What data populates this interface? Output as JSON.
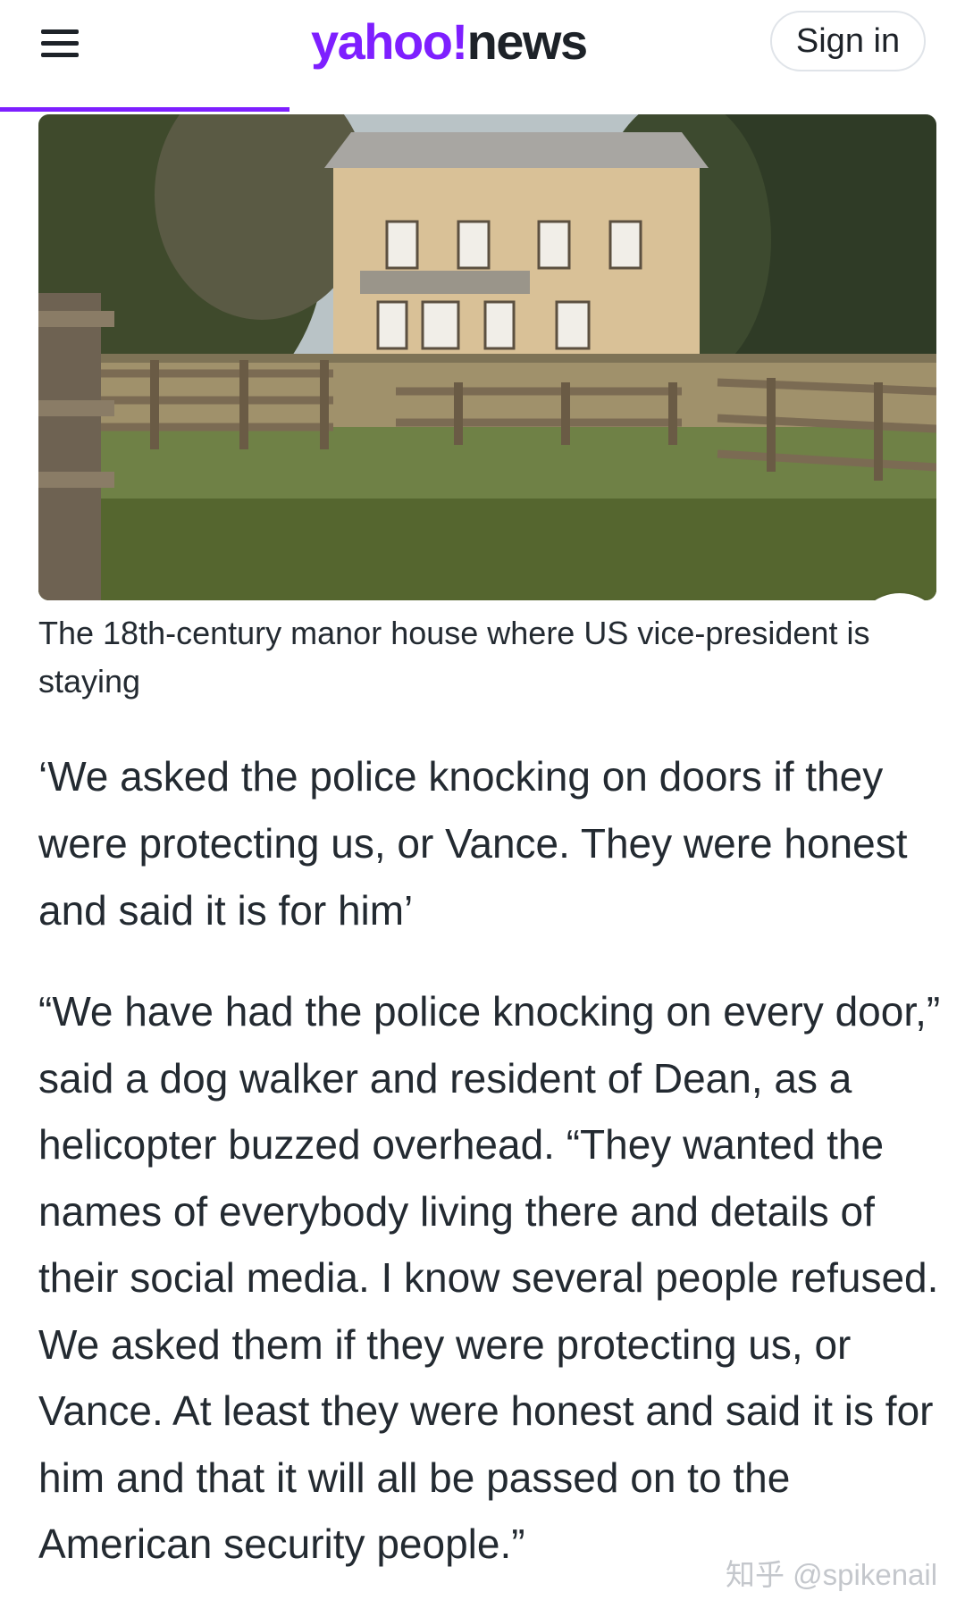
{
  "header": {
    "logo_yahoo": "yahoo",
    "logo_bang": "!",
    "logo_news": "news",
    "sign_in_label": "Sign in",
    "menu_icon": "hamburger-menu-icon",
    "reading_progress_percent": 30
  },
  "hero_image": {
    "expand_icon": "expand-arrows-icon"
  },
  "article": {
    "caption": "The 18th-century manor house where US vice-president is staying",
    "subheading": "‘We asked the police knocking on doors if they were protecting us, or Vance. They were honest and said it is for him’",
    "paragraph": "“We have had the police knocking on every door,” said a dog walker and resident of Dean, as a helicopter buzzed overhead. “They wanted the names of everybody living there and details of their social media. I know several people refused. We asked them if they were protecting us, or Vance. At least they were honest and said it is for him and that it will all be passed on to the American security people.”"
  },
  "watermark": "知乎 @spikenail",
  "colors": {
    "brand_purple": "#7e1fff",
    "text": "#232a31",
    "watermark": "#c4c7cc"
  }
}
